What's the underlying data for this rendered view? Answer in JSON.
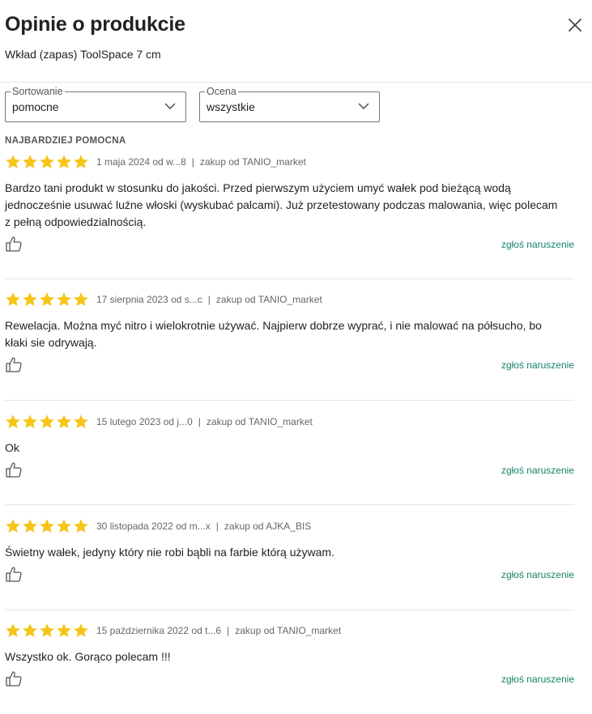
{
  "header": {
    "title": "Opinie o produkcie",
    "subtitle": "Wkład (zapas) ToolSpace 7 cm",
    "close_icon": "close-icon"
  },
  "filters": {
    "sort": {
      "legend": "Sortowanie",
      "value": "pomocne"
    },
    "rating": {
      "legend": "Ocena",
      "value": "wszystkie"
    }
  },
  "section_label": "NAJBARDZIEJ POMOCNA",
  "colors": {
    "star": "#f5c518",
    "link": "#17836d",
    "divider": "#e6e6e6"
  },
  "reviews": [
    {
      "stars": 5,
      "date_author": "1 maja 2024 od w...8",
      "purchase": "zakup od TANIO_market",
      "text": "Bardzo tani produkt w stosunku do jakości. Przed pierwszym użyciem umyć wałek pod bieżącą wodą jednocześnie usuwać luźne włoski (wyskubać palcami). Już przetestowany podczas malowania, więc polecam z pełną odpowiedzialnością.",
      "report": "zgłoś naruszenie"
    },
    {
      "stars": 5,
      "date_author": "17 sierpnia 2023 od s...c",
      "purchase": "zakup od TANIO_market",
      "text": "Rewelacja. Można myć nitro i wielokrotnie używać. Najpierw dobrze wyprać, i nie malować na półsucho, bo kłaki sie odrywają.",
      "report": "zgłoś naruszenie"
    },
    {
      "stars": 5,
      "date_author": "15 lutego 2023 od j...0",
      "purchase": "zakup od TANIO_market",
      "text": "Ok",
      "report": "zgłoś naruszenie"
    },
    {
      "stars": 5,
      "date_author": "30 listopada 2022 od m...x",
      "purchase": "zakup od AJKA_BIS",
      "text": "Świetny wałek, jedyny który nie robi bąbli na farbie którą używam.",
      "report": "zgłoś naruszenie"
    },
    {
      "stars": 5,
      "date_author": "15 października 2022 od t...6",
      "purchase": "zakup od TANIO_market",
      "text": "Wszystko ok. Gorąco polecam !!!",
      "report": "zgłoś naruszenie"
    }
  ]
}
